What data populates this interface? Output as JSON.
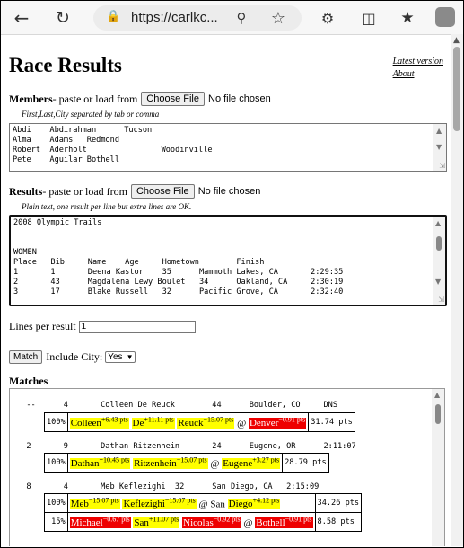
{
  "browser": {
    "url": "https://carlkc..."
  },
  "page": {
    "title": "Race Results",
    "links": [
      "Latest version",
      "About"
    ]
  },
  "members": {
    "label": "Members",
    "label_suffix": " - paste or load from",
    "file_button": "Choose File",
    "no_file": "No file chosen",
    "hint": "First,Last,City separated by tab or comma",
    "text": "Abdi\tAbdirahman\tTucson\nAlma\tAdams\tRedmond\nRobert\tAderholt\t\tWoodinville\nPete\tAguilar Bothell"
  },
  "results": {
    "label": "Results",
    "label_suffix": " - paste or load from",
    "file_button": "Choose File",
    "no_file": "No file chosen",
    "hint": "Plain text, one result per line but extra lines are OK.",
    "text": "2008 Olympic Trails\n\n\nWOMEN\nPlace   Bib     Name    Age     Hometown        Finish\n1       1       Deena Kastor    35      Mammoth Lakes, CA       2:29:35\n2       43      Magdalena Lewy Boulet   34      Oakland, CA     2:30:19\n3       17      Blake Russell   32      Pacific Grove, CA       2:32:40"
  },
  "controls": {
    "lines_per_result_label": "Lines per result",
    "lines_per_result_value": "1",
    "match_button": "Match",
    "include_city_label": "Include City:",
    "include_city_value": "Yes"
  },
  "matches": {
    "title": "Matches",
    "groups": [
      {
        "line": "  --      4       Colleen De Reuck        44      Boulder, CO     DNS",
        "candidates": [
          {
            "pct": "100%",
            "parts": [
              {
                "text": "Colleen",
                "pts": "+6.43 pts",
                "color": "yellow"
              },
              {
                "text": "De",
                "pts": "+11.11 pts",
                "color": "yellow"
              },
              {
                "text": "Reuck",
                "pts": "−15.07 pts",
                "color": "yellow"
              },
              {
                "text": "@",
                "pts": "",
                "color": "none"
              },
              {
                "text": "Denver",
                "pts": "−0.91 pts",
                "color": "red"
              }
            ],
            "score": "31.74 pts"
          }
        ]
      },
      {
        "line": "  2       9       Dathan Ritzenhein       24      Eugene, OR      2:11:07",
        "candidates": [
          {
            "pct": "100%",
            "parts": [
              {
                "text": "Dathan",
                "pts": "+10.45 pts",
                "color": "yellow"
              },
              {
                "text": "Ritzenhein",
                "pts": "−15.07 pts",
                "color": "yellow"
              },
              {
                "text": "@",
                "pts": "",
                "color": "none"
              },
              {
                "text": "Eugene",
                "pts": "+3.27 pts",
                "color": "yellow"
              }
            ],
            "score": "28.79 pts"
          }
        ]
      },
      {
        "line": "  8       4       Meb Keflezighi  32      San Diego, CA   2:15:09",
        "candidates": [
          {
            "pct": "100%",
            "parts": [
              {
                "text": "Meb",
                "pts": "−15.07 pts",
                "color": "yellow"
              },
              {
                "text": "Keflezighi",
                "pts": "−15.07 pts",
                "color": "yellow"
              },
              {
                "text": "@ San",
                "pts": "",
                "color": "none"
              },
              {
                "text": "Diego",
                "pts": "+4.12 pts",
                "color": "yellow"
              }
            ],
            "score": "34.26 pts"
          },
          {
            "pct": "15%",
            "parts": [
              {
                "text": "Michael",
                "pts": "−0.67 pts",
                "color": "red"
              },
              {
                "text": "San",
                "pts": "+11.07 pts",
                "color": "yellow"
              },
              {
                "text": "Nicolas",
                "pts": "−0.92 pts",
                "color": "red"
              },
              {
                "text": "@",
                "pts": "",
                "color": "none"
              },
              {
                "text": "Bothell",
                "pts": "−0.91 pts",
                "color": "red"
              }
            ],
            "score": "8.58 pts"
          }
        ]
      }
    ]
  },
  "colors": {
    "highlight_yes": "#ffff00",
    "highlight_no": "#ee0000"
  }
}
